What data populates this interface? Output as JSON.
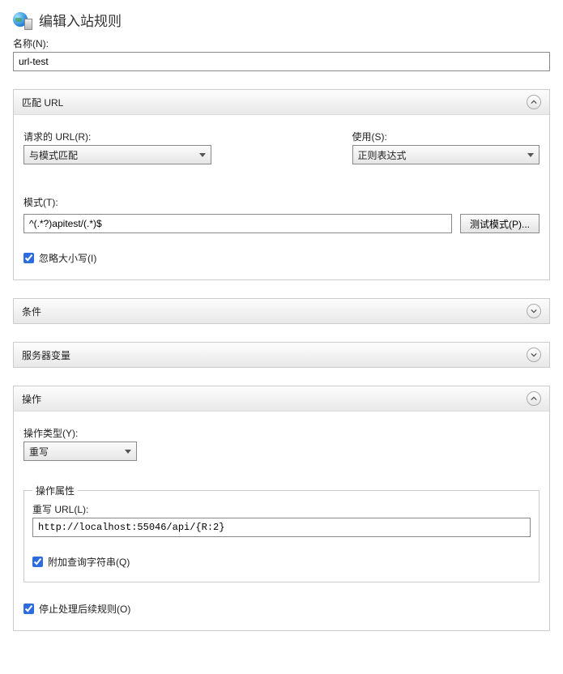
{
  "header": {
    "title": "编辑入站规则",
    "name_label": "名称(N):",
    "name_value": "url-test"
  },
  "match_url": {
    "panel_title": "匹配 URL",
    "requested_url_label": "请求的 URL(R):",
    "requested_url_value": "与模式匹配",
    "using_label": "使用(S):",
    "using_value": "正则表达式",
    "pattern_label": "模式(T):",
    "pattern_value": "^(.*?)apitest/(.*)$",
    "test_button": "测试模式(P)...",
    "ignore_case_label": "忽略大小写(I)"
  },
  "conditions": {
    "panel_title": "条件"
  },
  "server_vars": {
    "panel_title": "服务器变量"
  },
  "action": {
    "panel_title": "操作",
    "action_type_label": "操作类型(Y):",
    "action_type_value": "重写",
    "properties_legend": "操作属性",
    "rewrite_url_label": "重写 URL(L):",
    "rewrite_url_value": "http://localhost:55046/api/{R:2}",
    "append_query_label": "附加查询字符串(Q)",
    "stop_processing_label": "停止处理后续规则(O)"
  }
}
